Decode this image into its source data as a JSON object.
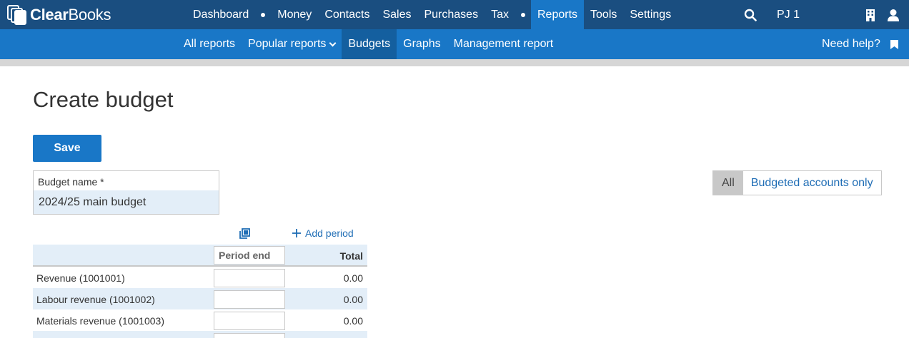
{
  "brand": {
    "name_bold": "Clear",
    "name_rest": "Books"
  },
  "nav": {
    "items": [
      {
        "label": "Dashboard"
      },
      {
        "label": "Money"
      },
      {
        "label": "Contacts"
      },
      {
        "label": "Sales"
      },
      {
        "label": "Purchases"
      },
      {
        "label": "Tax"
      },
      {
        "label": "Reports"
      },
      {
        "label": "Tools"
      },
      {
        "label": "Settings"
      }
    ],
    "active": "Reports",
    "user_label": "PJ 1"
  },
  "subnav": {
    "items": [
      {
        "label": "All reports"
      },
      {
        "label": "Popular reports"
      },
      {
        "label": "Budgets"
      },
      {
        "label": "Graphs"
      },
      {
        "label": "Management report"
      }
    ],
    "active": "Budgets",
    "help_label": "Need help?"
  },
  "page": {
    "title": "Create budget",
    "save_label": "Save",
    "budget_name": {
      "label": "Budget name *",
      "value": "2024/25 main budget"
    },
    "filter": {
      "all_label": "All",
      "budgeted_label": "Budgeted accounts only",
      "selected": "All"
    },
    "add_period_label": "Add period"
  },
  "table": {
    "period_end_placeholder": "Period end",
    "total_header": "Total",
    "rows": [
      {
        "name": "Revenue (1001001)",
        "value": "",
        "total": "0.00"
      },
      {
        "name": "Labour revenue (1001002)",
        "value": "",
        "total": "0.00"
      },
      {
        "name": "Materials revenue (1001003)",
        "value": "",
        "total": "0.00"
      }
    ]
  },
  "colors": {
    "topbar": "#1a4e80",
    "subbar": "#1977c7",
    "accent": "#1977c7",
    "link": "#1f6db5",
    "row_alt": "#e3eef8"
  }
}
